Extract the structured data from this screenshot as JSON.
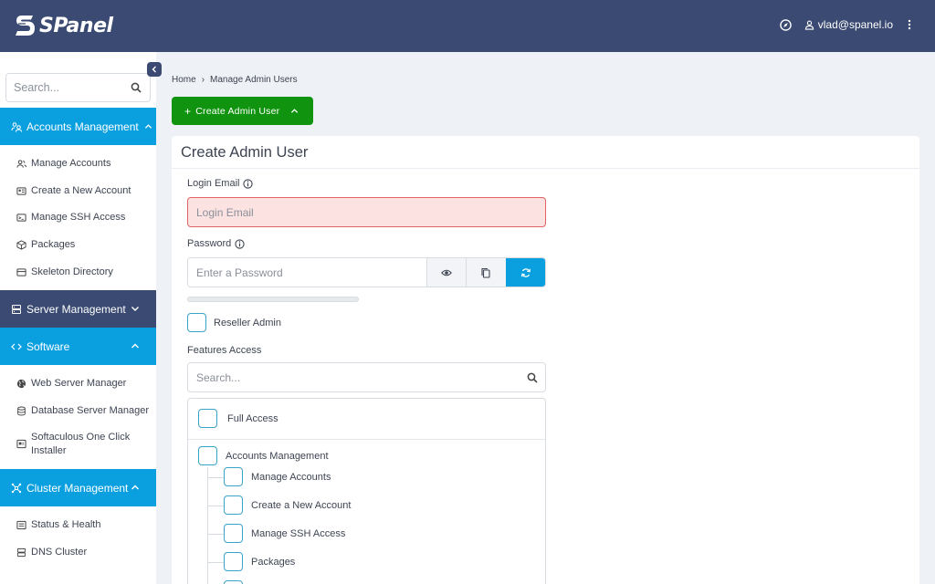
{
  "header": {
    "logo_text": "SPanel",
    "user_email": "vlad@spanel.io"
  },
  "sidebar": {
    "search_placeholder": "Search...",
    "sections": [
      {
        "label": "Accounts Management",
        "state": "expanded",
        "items": [
          "Manage Accounts",
          "Create a New Account",
          "Manage SSH Access",
          "Packages",
          "Skeleton Directory"
        ]
      },
      {
        "label": "Server Management",
        "state": "collapsed",
        "items": []
      },
      {
        "label": "Software",
        "state": "expanded",
        "items": [
          "Web Server Manager",
          "Database Server Manager",
          "Softaculous One Click Installer"
        ]
      },
      {
        "label": "Cluster Management",
        "state": "expanded",
        "items": [
          "Status & Health",
          "DNS Cluster"
        ]
      }
    ]
  },
  "breadcrumb": {
    "home": "Home",
    "current": "Manage Admin Users"
  },
  "create_button": {
    "label": "Create Admin User"
  },
  "form": {
    "title": "Create Admin User",
    "login_email_label": "Login Email",
    "login_email_placeholder": "Login Email",
    "password_label": "Password",
    "password_placeholder": "Enter a Password",
    "reseller_label": "Reseller Admin",
    "features_label": "Features Access",
    "features_search_placeholder": "Search...",
    "features": {
      "full_access": "Full Access",
      "group": "Accounts Management",
      "children": [
        "Manage Accounts",
        "Create a New Account",
        "Manage SSH Access",
        "Packages"
      ]
    }
  },
  "colors": {
    "topbar": "#3a4a72",
    "accent_blue": "#0aa0e0",
    "success_green": "#10930f",
    "error_bg": "#fde2e2",
    "error_border": "#e26363"
  }
}
